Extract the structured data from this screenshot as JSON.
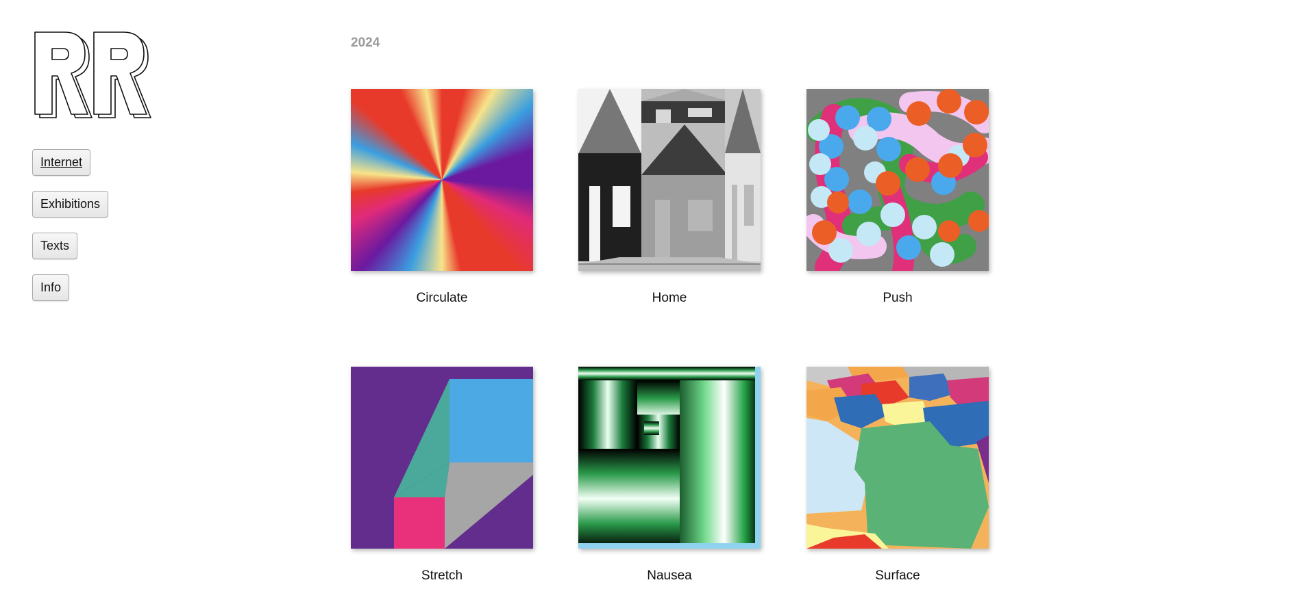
{
  "logo": {
    "text": "RR"
  },
  "nav": {
    "internet": "Internet",
    "exhibitions": "Exhibitions",
    "texts": "Texts",
    "info": "Info"
  },
  "section": {
    "year": "2024"
  },
  "works": [
    {
      "title": "Circulate"
    },
    {
      "title": "Home"
    },
    {
      "title": "Push"
    },
    {
      "title": "Stretch"
    },
    {
      "title": "Nausea"
    },
    {
      "title": "Surface"
    }
  ]
}
